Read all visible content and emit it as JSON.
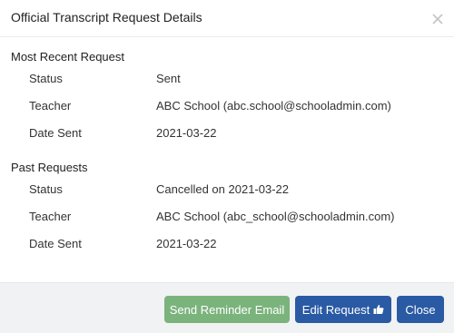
{
  "modal": {
    "title": "Official Transcript Request Details",
    "close_icon": "close-icon"
  },
  "most_recent": {
    "heading": "Most Recent Request",
    "rows": [
      {
        "label": "Status",
        "value": "Sent"
      },
      {
        "label": "Teacher",
        "value": "ABC School (abc.school@schooladmin.com)"
      },
      {
        "label": "Date Sent",
        "value": "2021-03-22"
      }
    ]
  },
  "past": {
    "heading": "Past Requests",
    "rows": [
      {
        "label": "Status",
        "value": "Cancelled on 2021-03-22"
      },
      {
        "label": "Teacher",
        "value": "ABC School (abc_school@schooladmin.com)"
      },
      {
        "label": "Date Sent",
        "value": "2021-03-22"
      }
    ]
  },
  "footer": {
    "reminder_label": "Send Reminder Email",
    "edit_label": "Edit Request",
    "edit_icon": "thumbs-up-icon",
    "close_label": "Close"
  },
  "colors": {
    "reminder_button": "#7bb37c",
    "primary_button": "#2a5aa4",
    "footer_bg": "#f1f2f3"
  }
}
